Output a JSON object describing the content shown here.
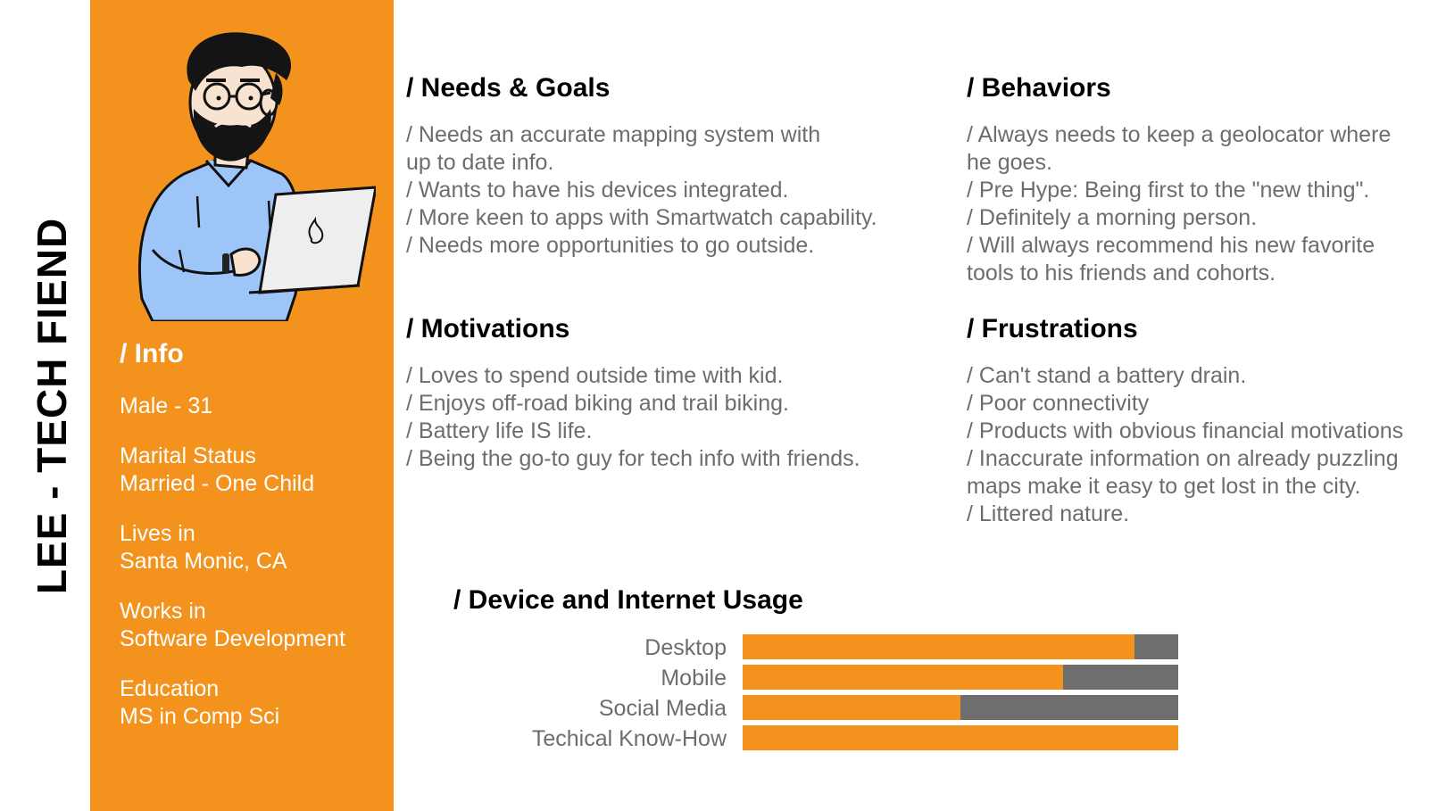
{
  "persona_title": "LEE - TECH FIEND",
  "info": {
    "heading": "/ Info",
    "items": [
      [
        "Male - 31"
      ],
      [
        "Marital Status",
        "Married - One Child"
      ],
      [
        "Lives in",
        "Santa Monic, CA"
      ],
      [
        "Works in",
        "Software Development"
      ],
      [
        "Education",
        "MS in Comp Sci"
      ]
    ]
  },
  "needs_goals": {
    "title": "/ Needs & Goals",
    "lines": [
      "/ Needs an accurate mapping system with",
      "up to date info.",
      "/ Wants to have his devices integrated.",
      "/ More keen to apps with Smartwatch capability.",
      "/ Needs more opportunities to go outside."
    ]
  },
  "behaviors": {
    "title": "/ Behaviors",
    "lines": [
      "/ Always needs to keep a geolocator where",
      "he goes.",
      "/ Pre Hype: Being first to the \"new thing\".",
      "/ Definitely a morning person.",
      "/ Will always recommend his new favorite",
      "tools to his friends and cohorts."
    ]
  },
  "motivations": {
    "title": "/ Motivations",
    "lines": [
      "/ Loves to spend outside time with kid.",
      "/ Enjoys off-road biking and trail biking.",
      "/ Battery life IS life.",
      "/ Being the go-to guy for tech info with friends."
    ]
  },
  "frustrations": {
    "title": "/ Frustrations",
    "lines": [
      "/ Can't stand a battery drain.",
      "/ Poor connectivity",
      "/ Products with obvious financial motivations",
      "/ Inaccurate information on already puzzling",
      "maps make it easy to get lost in the city.",
      "/ Littered nature."
    ]
  },
  "usage": {
    "title": "/ Device and Internet Usage",
    "bars": [
      {
        "label": "Desktop",
        "fraction": 0.9
      },
      {
        "label": "Mobile",
        "fraction": 0.735
      },
      {
        "label": "Social Media",
        "fraction": 0.5
      },
      {
        "label": "Techical Know-How",
        "fraction": 1.0
      }
    ]
  },
  "colors": {
    "accent": "#f3921c",
    "bar_background": "#6e6e6e",
    "body_text": "#6d6d6d",
    "shirt": "#9ec5f7"
  },
  "icons": {
    "avatar": "bearded-man-with-laptop-illustration",
    "laptop_logo": "flame-icon"
  }
}
